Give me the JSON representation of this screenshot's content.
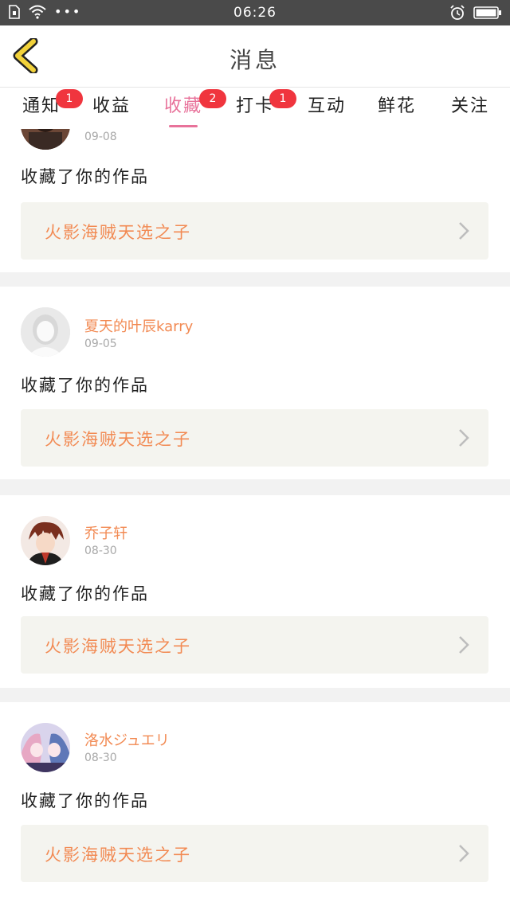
{
  "status_bar": {
    "time": "06:26",
    "icons": [
      "sim-icon",
      "wifi-icon",
      "more-dots-icon",
      "alarm-icon",
      "battery-icon"
    ],
    "dots": "•••"
  },
  "nav": {
    "title": "消息",
    "back_icon": "chevron-left-icon"
  },
  "tabs": [
    {
      "label": "通知",
      "badge": "1"
    },
    {
      "label": "收益",
      "badge": null
    },
    {
      "label": "收藏",
      "badge": "2",
      "active": true
    },
    {
      "label": "打卡",
      "badge": "1"
    },
    {
      "label": "互动",
      "badge": null
    },
    {
      "label": "鲜花",
      "badge": null
    },
    {
      "label": "关注",
      "badge": null
    }
  ],
  "feed": [
    {
      "username": "",
      "date": "09-08",
      "action": "收藏了你的作品",
      "work_title": "火影海贼天选之子"
    },
    {
      "username": "夏天的叶辰karry",
      "date": "09-05",
      "action": "收藏了你的作品",
      "work_title": "火影海贼天选之子"
    },
    {
      "username": "乔子轩",
      "date": "08-30",
      "action": "收藏了你的作品",
      "work_title": "火影海贼天选之子"
    },
    {
      "username": "洛水ジュエリ",
      "date": "08-30",
      "action": "收藏了你的作品",
      "work_title": "火影海贼天选之子"
    }
  ],
  "colors": {
    "accent": "#e8729a",
    "badge": "#f0353e",
    "username": "#f28a53",
    "card_bg": "#f4f4ef",
    "status_bar": "#4a4a4a",
    "back_icon": "#f2d23a"
  }
}
